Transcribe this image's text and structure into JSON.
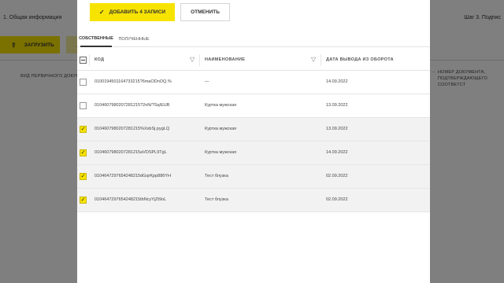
{
  "background": {
    "step_left": "1. Общая информация",
    "step_right": "Шаг 3. Подпис",
    "upload_label": "ЗАГРУЗИТЬ",
    "col_left": "ВИД ПЕРВИЧНОГО ДОКУМЕНТ",
    "col_mid": "...",
    "col_right_line1": "НОМЕР ДОКУМЕНТА,",
    "col_right_line2": "ПОДТВЕРЖДАЮЩЕГО СООТВЕТСТ"
  },
  "modal": {
    "add_button": "ДОБАВИТЬ 4 ЗАПИСИ",
    "cancel_button": "ОТМЕНИТЬ",
    "tabs": [
      {
        "label": "СОБСТВЕННЫЕ",
        "active": true
      },
      {
        "label": "ПОЛУЧЕННЫЕ",
        "active": false
      }
    ],
    "columns": {
      "code": "КОД",
      "name": "НАИМЕНОВАНИЕ",
      "date": "ДАТА ВЫВОДА ИЗ ОБОРОТА"
    },
    "rows": [
      {
        "code": "0100194501164733215?6maODnOQ.%",
        "name": "—",
        "date": "14.09.2022",
        "checked": false
      },
      {
        "code": "0104607980207281215?2nN/?Sq/EUB",
        "name": "Куртка мужская",
        "date": "13.09.2022",
        "checked": false
      },
      {
        "code": "0104607980207281215%XsbSj.pygLQ",
        "name": "Куртка мужская",
        "date": "13.09.2022",
        "checked": true
      },
      {
        "code": "0104607980207281215aVDSPL9TgL",
        "name": "Куртка мужская",
        "date": "14.09.2022",
        "checked": true
      },
      {
        "code": "0104647297654248215dGqrKpp886YH",
        "name": "Тест блузка",
        "date": "02.09.2022",
        "checked": true
      },
      {
        "code": "0104647297654248215tbNcyYjZt9oL",
        "name": "Тест блузка",
        "date": "02.09.2022",
        "checked": true
      }
    ]
  },
  "colors": {
    "accent": "#f7e300",
    "overlay": "rgba(0,0,0,0.5)",
    "selected_row": "#f2f2f2"
  },
  "icons": {
    "add": "check-icon",
    "upload": "upload-icon",
    "filter": "filter-icon"
  }
}
